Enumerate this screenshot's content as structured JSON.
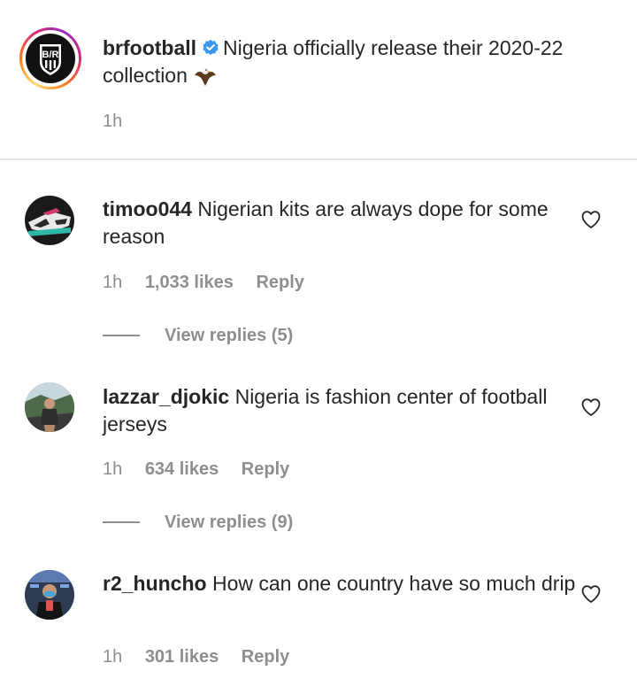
{
  "post": {
    "username": "brfootball",
    "verified_icon": "verified-badge-icon",
    "caption": "Nigeria officially release their 2020-22 collection",
    "emoji": "eagle-emoji",
    "time": "1h",
    "ring_colors": [
      "#feda75",
      "#fa7e1e",
      "#d62976",
      "#962fbf"
    ]
  },
  "comments": [
    {
      "username": "timoo044",
      "text": "Nigerian kits are always dope for some reason",
      "time": "1h",
      "likes": "1,033 likes",
      "reply_label": "Reply",
      "view_replies": "View replies (5)"
    },
    {
      "username": "lazzar_djokic",
      "text": "Nigeria is fashion center of football jerseys",
      "time": "1h",
      "likes": "634 likes",
      "reply_label": "Reply",
      "view_replies": "View replies (9)"
    },
    {
      "username": "r2_huncho",
      "text": "How can one country have so much drip",
      "time": "1h",
      "likes": "301 likes",
      "reply_label": "Reply"
    }
  ],
  "colors": {
    "text": "#262626",
    "secondary": "#8e8e8e",
    "verified": "#3897f0",
    "divider": "#e6e6e6"
  }
}
